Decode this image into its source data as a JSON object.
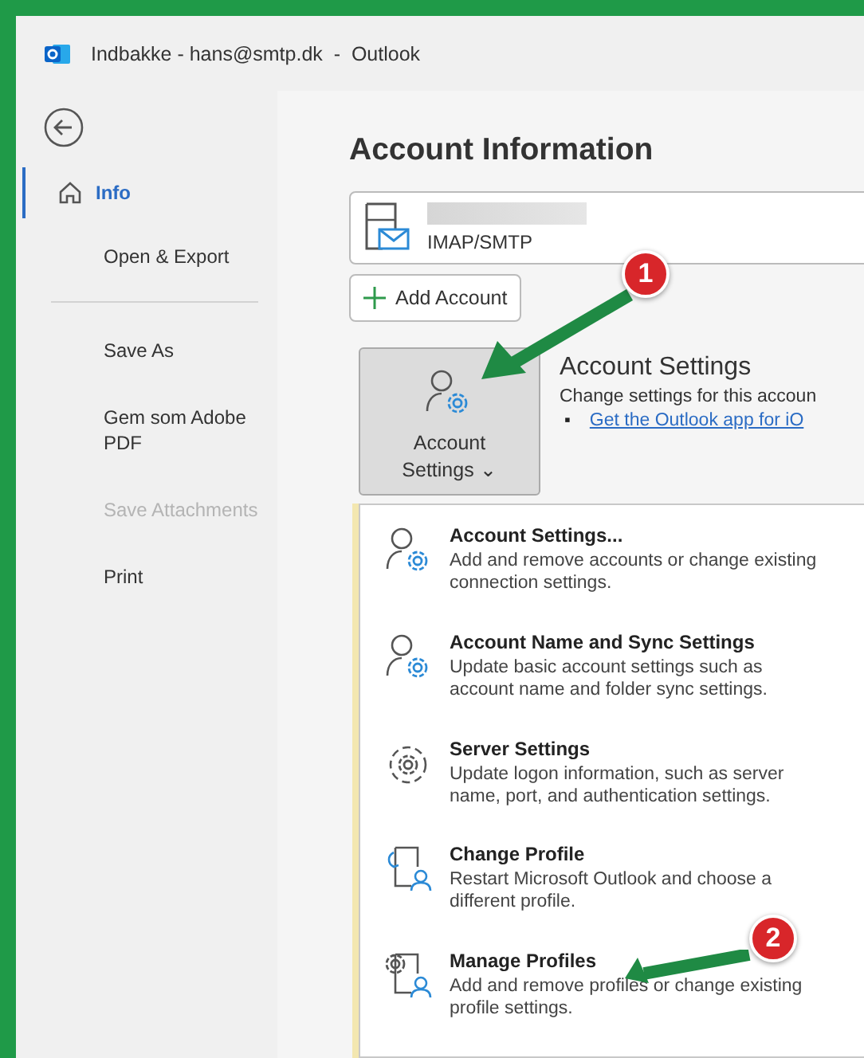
{
  "window": {
    "title": "Indbakke - hans@smtp.dk  -  Outlook"
  },
  "sidebar": {
    "groups": [
      [
        {
          "kind": "home",
          "label": "Info",
          "selected": true,
          "disabled": false
        },
        {
          "kind": "text",
          "label": "Open & Export",
          "selected": false,
          "disabled": false
        }
      ],
      [
        {
          "kind": "text",
          "label": "Save As",
          "selected": false,
          "disabled": false
        },
        {
          "kind": "text",
          "label": "Gem som Adobe PDF",
          "selected": false,
          "disabled": false
        },
        {
          "kind": "text",
          "label": "Save Attachments",
          "selected": false,
          "disabled": true
        },
        {
          "kind": "text",
          "label": "Print",
          "selected": false,
          "disabled": false
        }
      ]
    ]
  },
  "main": {
    "heading": "Account Information",
    "account": {
      "type": "IMAP/SMTP"
    },
    "add_account": "Add Account",
    "settings_button": {
      "label_line1": "Account",
      "label_line2": "Settings",
      "caret": "⌄"
    },
    "settings_section": {
      "title": "Account Settings",
      "description": "Change settings for this accoun",
      "bullet": "▪",
      "link": "Get the Outlook app for iO"
    },
    "menu": [
      {
        "kind": "account",
        "title": "Account Settings...",
        "description": "Add and remove accounts or change existing connection settings."
      },
      {
        "kind": "account",
        "title": "Account Name and Sync Settings",
        "description": "Update basic account settings such as account name and folder sync settings."
      },
      {
        "kind": "server",
        "title": "Server Settings",
        "description": "Update logon information, such as server name, port, and authentication settings."
      },
      {
        "kind": "change-profile",
        "title": "Change Profile",
        "description": "Restart Microsoft Outlook and choose a different profile."
      },
      {
        "kind": "manage-profiles",
        "title": "Manage Profiles",
        "description": "Add and remove profiles or change existing profile settings."
      }
    ]
  },
  "annotations": [
    {
      "label": "1"
    },
    {
      "label": "2"
    }
  ]
}
